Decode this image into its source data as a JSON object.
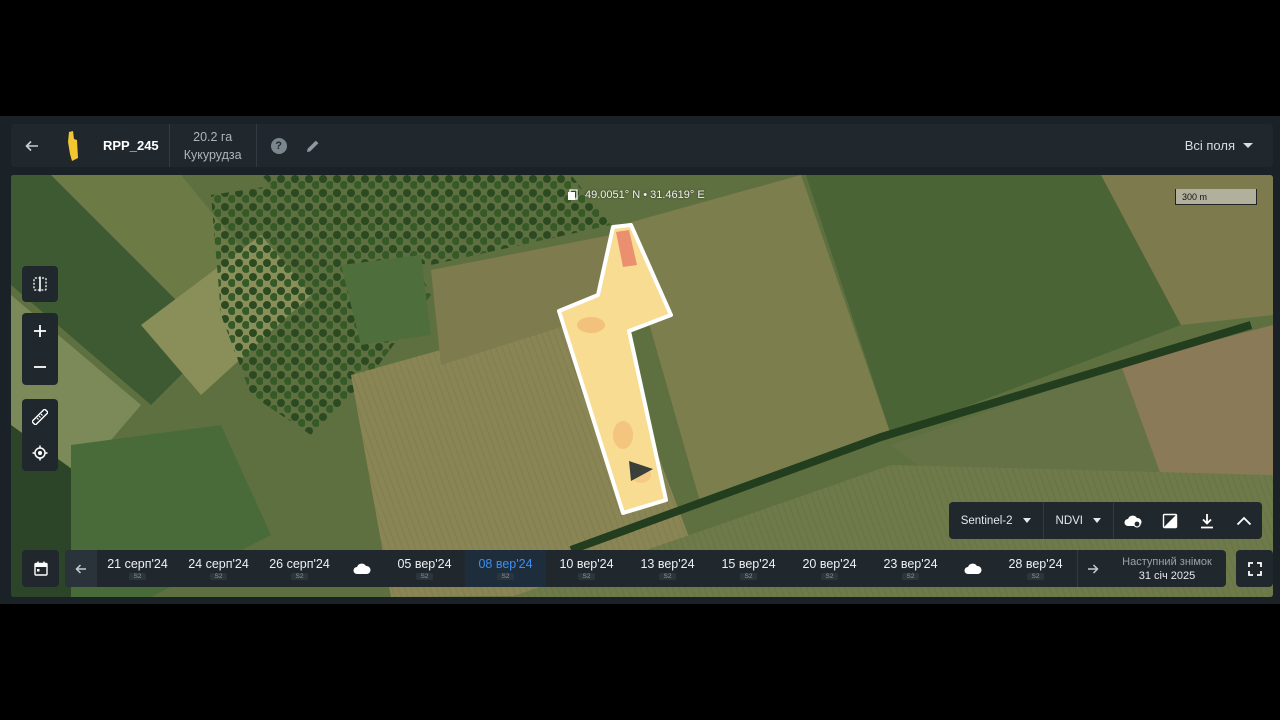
{
  "header": {
    "field_name": "RPP_245",
    "area": "20.2 га",
    "crop": "Кукурудза",
    "help_symbol": "?",
    "all_fields_label": "Всі поля"
  },
  "map": {
    "coordinates": "49.0051° N • 31.4619° E",
    "scale_label": "300 m"
  },
  "layers": {
    "source": "Sentinel-2",
    "index": "NDVI"
  },
  "timeline": {
    "dates": [
      {
        "date": "21 серп'24",
        "sat": "S2",
        "selected": false
      },
      {
        "date": "24 серп'24",
        "sat": "S2",
        "selected": false
      },
      {
        "date": "26 серп'24",
        "sat": "S2",
        "selected": false
      },
      {
        "date": "05 вер'24",
        "sat": "S2",
        "selected": false
      },
      {
        "date": "08 вер'24",
        "sat": "S2",
        "selected": true
      },
      {
        "date": "10 вер'24",
        "sat": "S2",
        "selected": false
      },
      {
        "date": "13 вер'24",
        "sat": "S2",
        "selected": false
      },
      {
        "date": "15 вер'24",
        "sat": "S2",
        "selected": false
      },
      {
        "date": "20 вер'24",
        "sat": "S2",
        "selected": false
      },
      {
        "date": "23 вер'24",
        "sat": "S2",
        "selected": false
      },
      {
        "date": "28 вер'24",
        "sat": "S2",
        "selected": false
      }
    ],
    "next_snapshot_title": "Наступний знімок",
    "next_snapshot_date": "31 січ 2025"
  },
  "colors": {
    "accent": "#3d8ef0",
    "panel": "#20282e",
    "field_fill": "#f8dc92",
    "field_low": "#e8836a"
  }
}
